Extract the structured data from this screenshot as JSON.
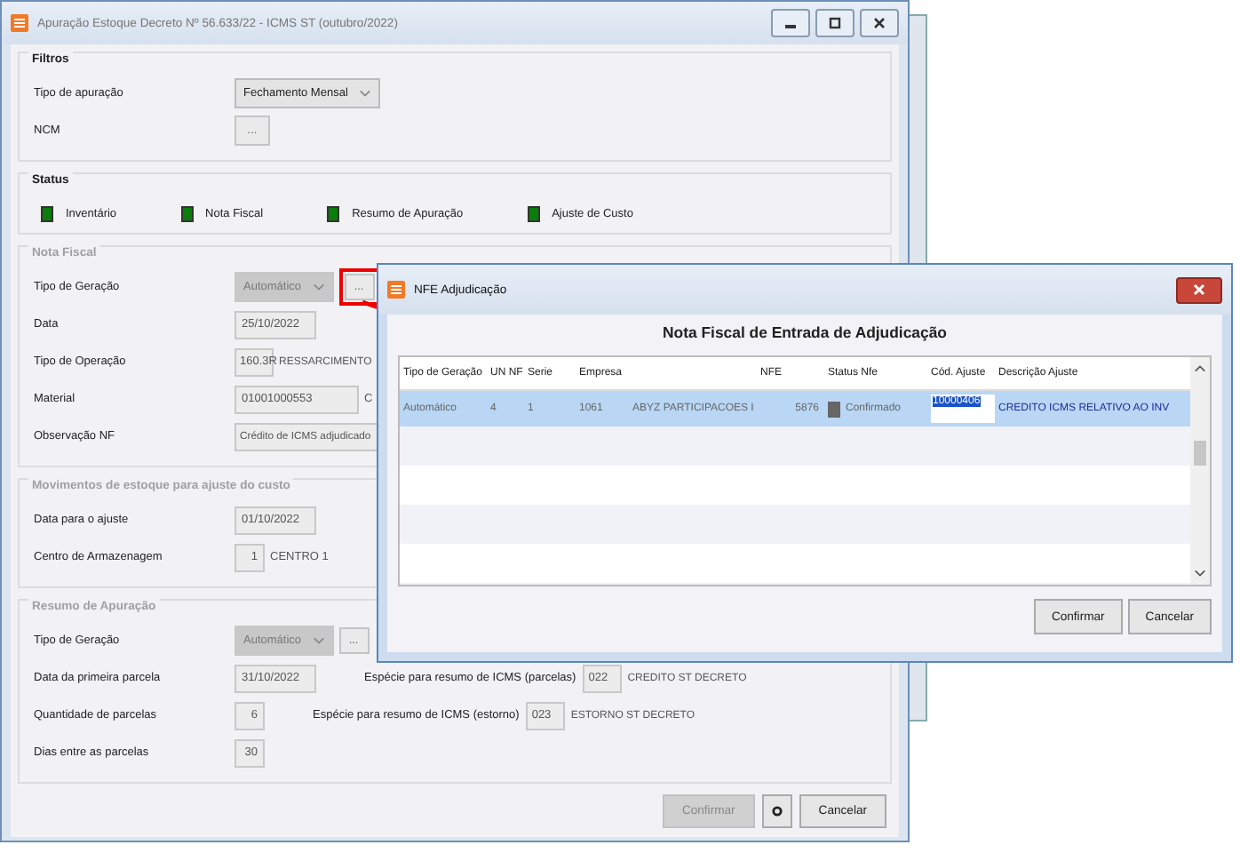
{
  "main_window": {
    "title": "Apuração Estoque Decreto Nº 56.633/22 - ICMS ST (outubro/2022)",
    "sections": [
      {
        "title": "Filtros",
        "disabled": false,
        "kind": "form",
        "rows": [
          {
            "label": "Tipo de apuração",
            "fields": [
              {
                "kind": "select",
                "value": "Fechamento Mensal"
              }
            ]
          },
          {
            "label": "NCM",
            "fields": [
              {
                "kind": "wide-button",
                "value": "..."
              }
            ]
          }
        ]
      },
      {
        "title": "Status",
        "disabled": false,
        "kind": "status",
        "items": [
          {
            "label": "Inventário",
            "color": "#0a7d0a"
          },
          {
            "label": "Nota Fiscal",
            "color": "#0a7d0a"
          },
          {
            "label": "Resumo de Apuração",
            "color": "#0a7d0a"
          },
          {
            "label": "Ajuste de Custo",
            "color": "#0a7d0a"
          }
        ]
      },
      {
        "title": "Nota Fiscal",
        "disabled": true,
        "kind": "form",
        "rows": [
          {
            "label": "Tipo de Geração",
            "fields": [
              {
                "kind": "select",
                "value": "Automático",
                "disabled": true
              },
              {
                "kind": "button",
                "value": "...",
                "highlighted": true
              }
            ]
          },
          {
            "label": "Data",
            "fields": [
              {
                "kind": "date",
                "value": "25/10/2022"
              }
            ]
          },
          {
            "label": "Tipo de Operação",
            "fields": [
              {
                "kind": "code",
                "value": "160.3R"
              },
              {
                "kind": "text",
                "value": "RESSARCIMENTO"
              }
            ]
          },
          {
            "label": "Material",
            "fields": [
              {
                "kind": "field",
                "value": "01001000553"
              },
              {
                "kind": "text",
                "value": "C"
              }
            ]
          },
          {
            "label": "Observação NF",
            "fields": [
              {
                "kind": "wide",
                "value": "Crédito de ICMS adjudicado"
              }
            ]
          }
        ]
      },
      {
        "title": "Movimentos de estoque para ajuste do custo",
        "disabled": true,
        "kind": "form",
        "rows": [
          {
            "label": "Data para o ajuste",
            "fields": [
              {
                "kind": "date",
                "value": "01/10/2022"
              }
            ]
          },
          {
            "label": "Centro de Armazenagem",
            "fields": [
              {
                "kind": "number",
                "value": "1"
              },
              {
                "kind": "text",
                "value": "CENTRO 1"
              }
            ]
          }
        ]
      },
      {
        "title": "Resumo de Apuração",
        "disabled": true,
        "kind": "form",
        "rows": [
          {
            "label": "Tipo de Geração",
            "fields": [
              {
                "kind": "select",
                "value": "Automático",
                "disabled": true
              },
              {
                "kind": "button",
                "value": "...",
                "highlighted": false
              }
            ]
          },
          {
            "label": "Data da primeira parcela",
            "fields": [
              {
                "kind": "date",
                "value": "31/10/2022"
              },
              {
                "kind": "label",
                "value": "Espécie para resumo de ICMS (parcelas)"
              },
              {
                "kind": "code",
                "value": "022"
              },
              {
                "kind": "text",
                "value": "CREDITO ST DECRETO"
              }
            ]
          },
          {
            "label": "Quantidade de parcelas",
            "fields": [
              {
                "kind": "number",
                "value": "6"
              },
              {
                "kind": "label",
                "value": "Espécie para resumo de ICMS (estorno)"
              },
              {
                "kind": "code",
                "value": "023"
              },
              {
                "kind": "text",
                "value": "ESTORNO ST DECRETO"
              }
            ]
          },
          {
            "label": "Dias entre as parcelas",
            "fields": [
              {
                "kind": "number",
                "value": "30"
              }
            ]
          }
        ]
      }
    ],
    "buttons": [
      {
        "kind": "text",
        "label": "Confirmar",
        "disabled": true
      },
      {
        "kind": "gear",
        "disabled": false
      },
      {
        "kind": "text",
        "label": "Cancelar",
        "disabled": false
      }
    ]
  },
  "dialog": {
    "title": "NFE Adjudicação",
    "heading": "Nota Fiscal de Entrada de Adjudicação",
    "table": {
      "columns": [
        {
          "label": "Tipo de Geração",
          "kind": "text"
        },
        {
          "label": "UN NF",
          "kind": "text"
        },
        {
          "label": "Serie",
          "kind": "text"
        },
        {
          "label": "Empresa",
          "kind": "text"
        },
        {
          "kind": "text"
        },
        {
          "label": "NFE",
          "kind": "numeric"
        },
        {
          "label": "Status Nfe",
          "kind": "status"
        },
        {
          "label": "Cód. Ajuste",
          "kind": "editing"
        },
        {
          "label": "Descrição Ajuste",
          "kind": "emphasis"
        }
      ],
      "rows": [
        {
          "selected": true,
          "cells": [
            "Automático",
            "4",
            "1",
            "1061",
            "ABYZ PARTICIPACOES I",
            "5876",
            "Confirmado",
            "10000406",
            "CREDITO ICMS RELATIVO AO INV"
          ]
        }
      ]
    },
    "buttons": [
      "Confirmar",
      "Cancelar"
    ]
  }
}
